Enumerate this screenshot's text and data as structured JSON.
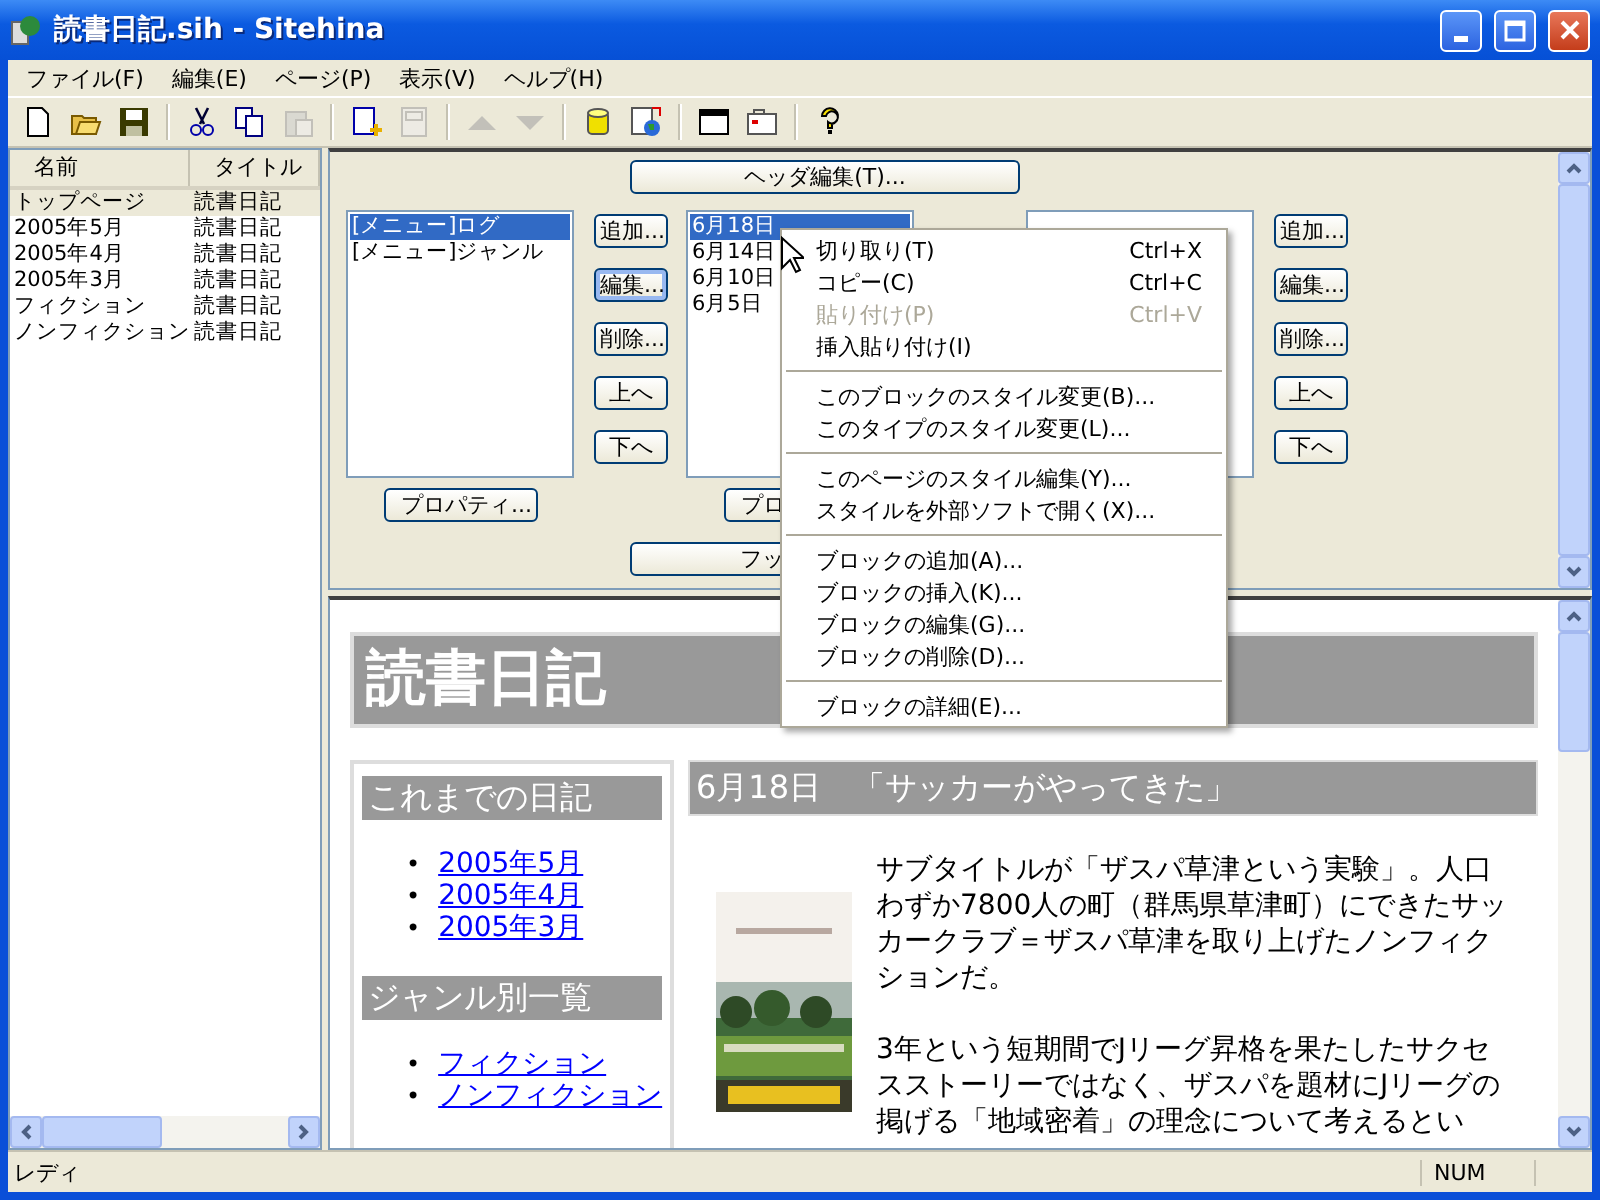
{
  "window": {
    "title": "読書日記.sih - Sitehina"
  },
  "menu": [
    "ファイル(F)",
    "編集(E)",
    "ページ(P)",
    "表示(V)",
    "ヘルプ(H)"
  ],
  "toolbar": [
    {
      "kind": "new",
      "disabled": false
    },
    {
      "kind": "open",
      "disabled": false
    },
    {
      "kind": "save",
      "disabled": false
    },
    {
      "kind": "sep"
    },
    {
      "kind": "cut",
      "disabled": false
    },
    {
      "kind": "copy",
      "disabled": false
    },
    {
      "kind": "paste",
      "disabled": true
    },
    {
      "kind": "sep"
    },
    {
      "kind": "newpage",
      "disabled": false
    },
    {
      "kind": "page",
      "disabled": true
    },
    {
      "kind": "sep"
    },
    {
      "kind": "up",
      "disabled": true
    },
    {
      "kind": "down",
      "disabled": true
    },
    {
      "kind": "sep"
    },
    {
      "kind": "cylinder",
      "disabled": false
    },
    {
      "kind": "globe",
      "disabled": false
    },
    {
      "kind": "sep"
    },
    {
      "kind": "window",
      "disabled": false
    },
    {
      "kind": "card",
      "disabled": false
    },
    {
      "kind": "sep"
    },
    {
      "kind": "help",
      "disabled": false
    }
  ],
  "page_list": {
    "columns": [
      "名前",
      "タイトル"
    ],
    "rows": [
      {
        "name": "トップページ",
        "title": "読書日記",
        "selected": true
      },
      {
        "name": "2005年5月",
        "title": "読書日記",
        "selected": false
      },
      {
        "name": "2005年4月",
        "title": "読書日記",
        "selected": false
      },
      {
        "name": "2005年3月",
        "title": "読書日記",
        "selected": false
      },
      {
        "name": "フィクション",
        "title": "読書日記",
        "selected": false
      },
      {
        "name": "ノンフィクション",
        "title": "読書日記",
        "selected": false
      }
    ]
  },
  "editor": {
    "header_button": "ヘッダ編集(T)...",
    "footer_button": "フッ",
    "groups": [
      {
        "items": [
          {
            "label": "[メニュー]ログ",
            "selected": true
          },
          {
            "label": "[メニュー]ジャンル",
            "selected": false
          }
        ],
        "property_button": "プロパティ...",
        "buttons": [
          {
            "label": "追加...",
            "focused": false
          },
          {
            "label": "編集...",
            "focused": true
          },
          {
            "label": "削除...",
            "focused": false
          },
          {
            "label": "上へ",
            "focused": false
          },
          {
            "label": "下へ",
            "focused": false
          }
        ]
      },
      {
        "items": [
          {
            "label": "6月18日",
            "selected": true
          },
          {
            "label": "6月14日",
            "selected": false
          },
          {
            "label": "6月10日",
            "selected": false
          },
          {
            "label": "6月5日",
            "selected": false
          }
        ],
        "property_button": "プロ"
      },
      {
        "buttons": [
          {
            "label": "追加...",
            "focused": false
          },
          {
            "label": "編集...",
            "focused": false
          },
          {
            "label": "削除...",
            "focused": false
          },
          {
            "label": "上へ",
            "focused": false
          },
          {
            "label": "下へ",
            "focused": false
          }
        ]
      }
    ]
  },
  "context_menu": {
    "sections": [
      [
        {
          "label": "切り取り(T)",
          "shortcut": "Ctrl+X",
          "disabled": false
        },
        {
          "label": "コピー(C)",
          "shortcut": "Ctrl+C",
          "disabled": false
        },
        {
          "label": "貼り付け(P)",
          "shortcut": "Ctrl+V",
          "disabled": true
        },
        {
          "label": "挿入貼り付け(I)",
          "disabled": false
        }
      ],
      [
        {
          "label": "このブロックのスタイル変更(B)...",
          "disabled": false
        },
        {
          "label": "このタイプのスタイル変更(L)...",
          "disabled": false
        }
      ],
      [
        {
          "label": "このページのスタイル編集(Y)...",
          "disabled": false
        },
        {
          "label": "スタイルを外部ソフトで開く(X)...",
          "disabled": false
        }
      ],
      [
        {
          "label": "ブロックの追加(A)...",
          "disabled": false
        },
        {
          "label": "ブロックの挿入(K)...",
          "disabled": false
        },
        {
          "label": "ブロックの編集(G)...",
          "disabled": false
        },
        {
          "label": "ブロックの削除(D)...",
          "disabled": false
        }
      ],
      [
        {
          "label": "ブロックの詳細(E)...",
          "disabled": false
        }
      ]
    ]
  },
  "preview": {
    "title": "読書日記",
    "sidebar": [
      {
        "heading": "これまでの日記",
        "marker": "•",
        "links": [
          "2005年5月",
          "2005年4月",
          "2005年3月"
        ]
      },
      {
        "heading": "ジャンル別一覧",
        "marker": "•",
        "links": [
          "フィクション",
          "ノンフィクション"
        ]
      }
    ],
    "article": {
      "heading": "6月18日　「サッカーがやってきた」",
      "paragraphs": [
        "サブタイトルが「ザスパ草津という実験」。人口わずか7800人の町（群馬県草津町）にできたサッカークラブ＝ザスパ草津を取り上げたノンフィクションだ。",
        "3年という短期間でJリーグ昇格を果たしたサクセスストーリーではなく、ザスパを題材にJリーグの掲げる「地域密着」の理念について考えるとい"
      ]
    }
  },
  "status_bar": {
    "message": "レディ",
    "indicator": "NUM"
  }
}
